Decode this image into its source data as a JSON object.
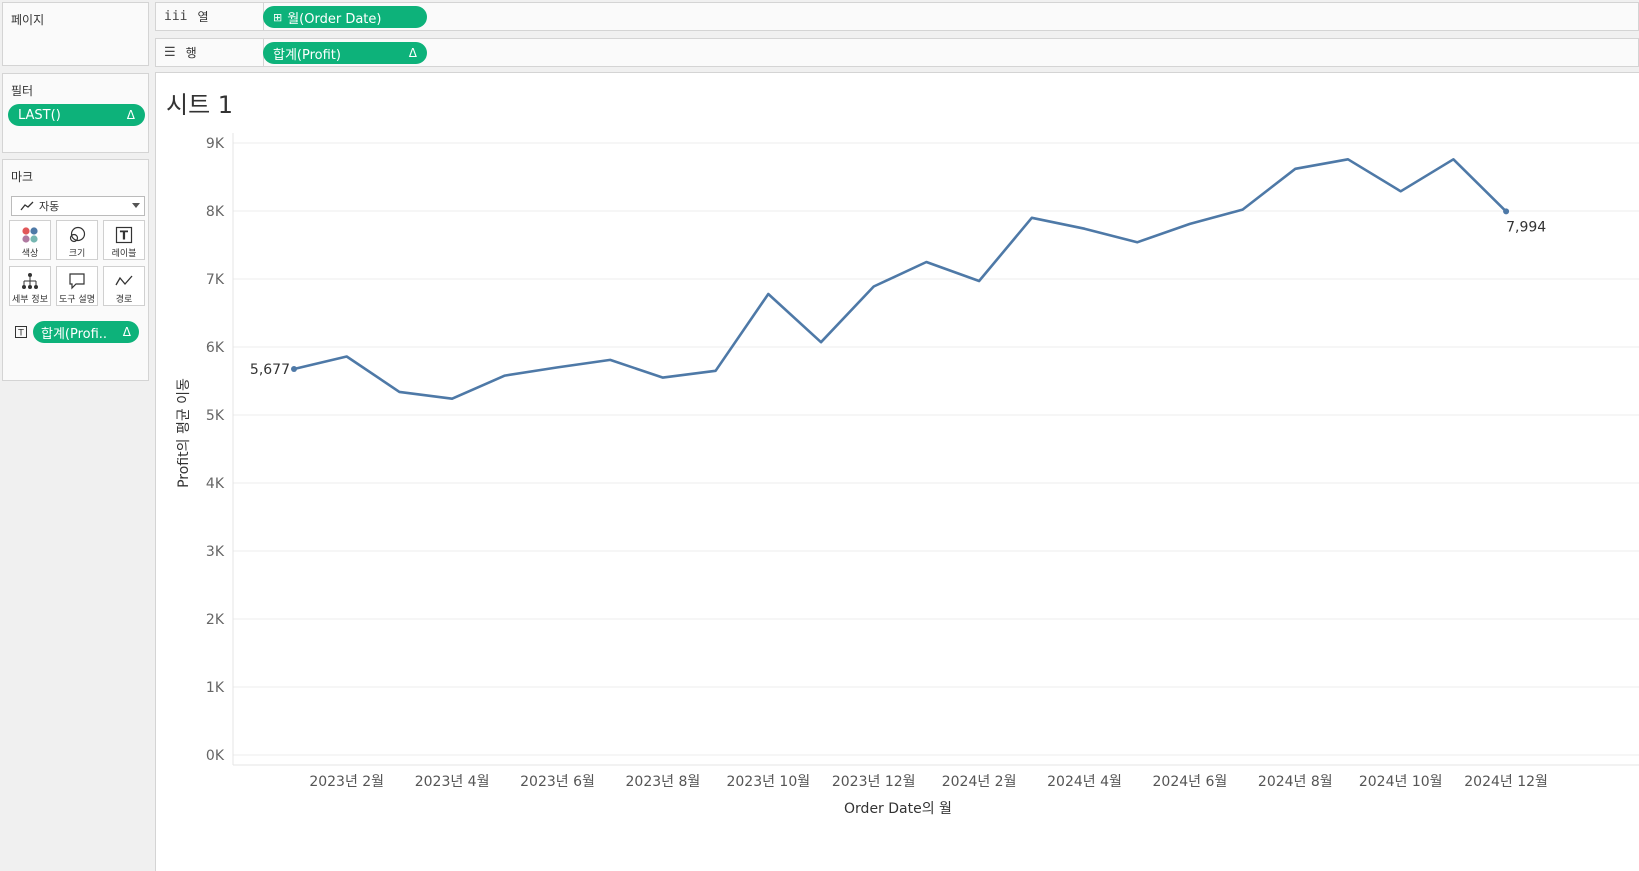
{
  "pages_panel": {
    "title": "페이지"
  },
  "columns_shelf": {
    "label": "열",
    "icon": "iii",
    "pill": "월(Order Date)",
    "pill_icon": "⊞"
  },
  "rows_shelf": {
    "label": "행",
    "icon": "☰",
    "pill": "합계(Profit)",
    "delta": "Δ"
  },
  "filters_panel": {
    "title": "필터",
    "pill": "LAST()",
    "delta": "Δ"
  },
  "marks_panel": {
    "title": "마크",
    "mark_type": "자동",
    "buttons": [
      {
        "label": "색상",
        "icon": "color-icon"
      },
      {
        "label": "크기",
        "icon": "size-icon"
      },
      {
        "label": "레이블",
        "icon": "label-icon"
      },
      {
        "label": "세부 정보",
        "icon": "detail-icon"
      },
      {
        "label": "도구 설명",
        "icon": "tooltip-icon"
      },
      {
        "label": "경로",
        "icon": "path-icon"
      }
    ],
    "field_pill": "합계(Profi..",
    "field_delta": "Δ"
  },
  "sheet": {
    "title": "시트 1"
  },
  "chart_data": {
    "type": "line",
    "xlabel": "Order Date의 월",
    "ylabel": "Profit의 평균 이동",
    "ylim": [
      0,
      9000
    ],
    "y_ticks": [
      "0K",
      "1K",
      "2K",
      "3K",
      "4K",
      "5K",
      "6K",
      "7K",
      "8K",
      "9K"
    ],
    "x_tick_labels": [
      "2023년 2월",
      "2023년 4월",
      "2023년 6월",
      "2023년 8월",
      "2023년 10월",
      "2023년 12월",
      "2024년 2월",
      "2024년 4월",
      "2024년 6월",
      "2024년 8월",
      "2024년 10월",
      "2024년 12월"
    ],
    "x": [
      "2023-01",
      "2023-02",
      "2023-03",
      "2023-04",
      "2023-05",
      "2023-06",
      "2023-07",
      "2023-08",
      "2023-09",
      "2023-10",
      "2023-11",
      "2023-12",
      "2024-01",
      "2024-02",
      "2024-03",
      "2024-04",
      "2024-05",
      "2024-06",
      "2024-07",
      "2024-08",
      "2024-09",
      "2024-10",
      "2024-11",
      "2024-12"
    ],
    "values": [
      5677,
      5860,
      5340,
      5240,
      5580,
      5700,
      5810,
      5550,
      5650,
      6780,
      6070,
      6890,
      7250,
      6970,
      7900,
      7740,
      7540,
      7810,
      8020,
      8620,
      8760,
      8290,
      8760,
      7994
    ],
    "data_labels": [
      {
        "index": 0,
        "text": "5,677"
      },
      {
        "index": 23,
        "text": "7,994"
      }
    ],
    "line_color": "#4e79a7",
    "grid": true
  }
}
